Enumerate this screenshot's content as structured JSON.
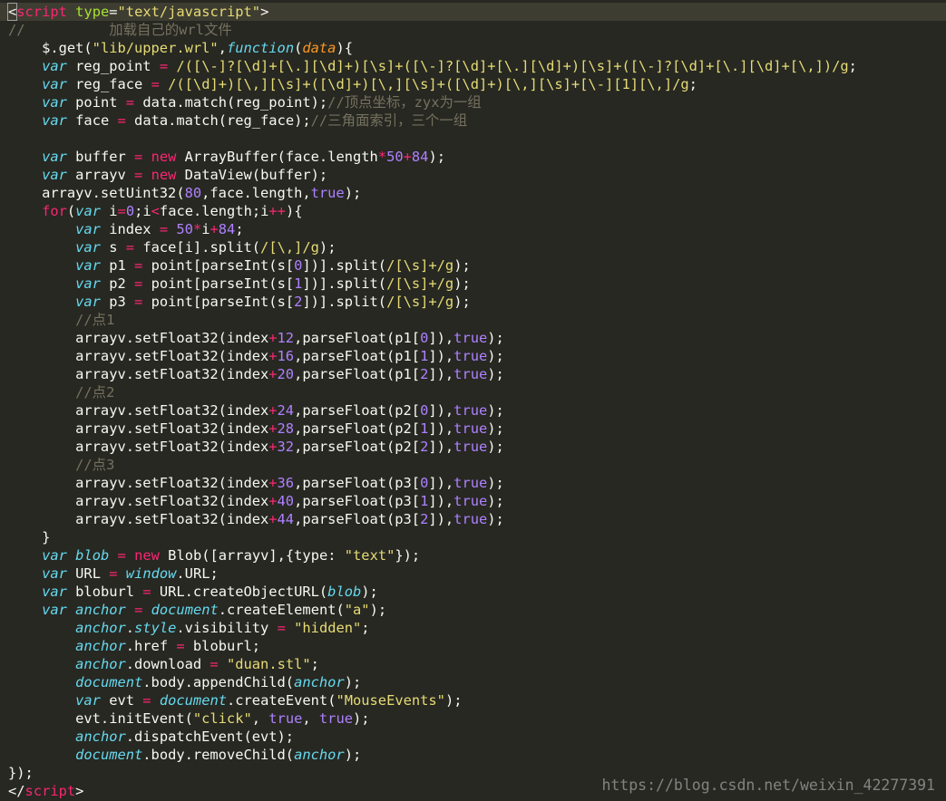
{
  "editor": {
    "theme": {
      "background": "#272822",
      "current_line": "#3e3d32",
      "foreground": "#f8f8f2",
      "keyword": "#f92672",
      "string": "#e6db74",
      "number": "#ae81ff",
      "comment": "#75715e",
      "storage": "#66d9ef",
      "attribute": "#a6e22e",
      "parameter": "#fd971f"
    },
    "lines": [
      [
        [
          "t",
          "<"
        ],
        [
          "k",
          "script"
        ],
        [
          "t",
          " "
        ],
        [
          "a",
          "type"
        ],
        [
          "t",
          "="
        ],
        [
          "s",
          "\"text/javascript\""
        ],
        [
          "t",
          ">"
        ]
      ],
      [
        [
          "c",
          "//          加载自己的wrl文件"
        ]
      ],
      [
        [
          "t",
          "    $.get("
        ],
        [
          "s",
          "\"lib/upper.wrl\""
        ],
        [
          "t",
          ","
        ],
        [
          "v",
          "function"
        ],
        [
          "t",
          "("
        ],
        [
          "p",
          "data"
        ],
        [
          "t",
          "){"
        ]
      ],
      [
        [
          "t",
          "    "
        ],
        [
          "v",
          "var"
        ],
        [
          "t",
          " reg_point "
        ],
        [
          "k",
          "="
        ],
        [
          "t",
          " "
        ],
        [
          "s",
          "/([\\-]?[\\d]+[\\.][\\d]+)[\\s]+([\\-]?[\\d]+[\\.][\\d]+)[\\s]+([\\-]?[\\d]+[\\.][\\d]+[\\,])/g"
        ],
        [
          "t",
          ";"
        ]
      ],
      [
        [
          "t",
          "    "
        ],
        [
          "v",
          "var"
        ],
        [
          "t",
          " reg_face "
        ],
        [
          "k",
          "="
        ],
        [
          "t",
          " "
        ],
        [
          "s",
          "/([\\d]+)[\\,][\\s]+([\\d]+)[\\,][\\s]+([\\d]+)[\\,][\\s]+[\\-][1][\\,]/g"
        ],
        [
          "t",
          ";"
        ]
      ],
      [
        [
          "t",
          "    "
        ],
        [
          "v",
          "var"
        ],
        [
          "t",
          " point "
        ],
        [
          "k",
          "="
        ],
        [
          "t",
          " data.match(reg_point);"
        ],
        [
          "c",
          "//顶点坐标，zyx为一组"
        ]
      ],
      [
        [
          "t",
          "    "
        ],
        [
          "v",
          "var"
        ],
        [
          "t",
          " face "
        ],
        [
          "k",
          "="
        ],
        [
          "t",
          " data.match(reg_face);"
        ],
        [
          "c",
          "//三角面索引，三个一组"
        ]
      ],
      [
        [
          "t",
          ""
        ]
      ],
      [
        [
          "t",
          "    "
        ],
        [
          "v",
          "var"
        ],
        [
          "t",
          " buffer "
        ],
        [
          "k",
          "="
        ],
        [
          "t",
          " "
        ],
        [
          "k",
          "new"
        ],
        [
          "t",
          " ArrayBuffer(face.length"
        ],
        [
          "k",
          "*"
        ],
        [
          "n",
          "50"
        ],
        [
          "k",
          "+"
        ],
        [
          "n",
          "84"
        ],
        [
          "t",
          ");"
        ]
      ],
      [
        [
          "t",
          "    "
        ],
        [
          "v",
          "var"
        ],
        [
          "t",
          " arrayv "
        ],
        [
          "k",
          "="
        ],
        [
          "t",
          " "
        ],
        [
          "k",
          "new"
        ],
        [
          "t",
          " DataView(buffer);"
        ]
      ],
      [
        [
          "t",
          "    arrayv.setUint32("
        ],
        [
          "n",
          "80"
        ],
        [
          "t",
          ",face.length,"
        ],
        [
          "n",
          "true"
        ],
        [
          "t",
          ");"
        ]
      ],
      [
        [
          "t",
          "    "
        ],
        [
          "k",
          "for"
        ],
        [
          "t",
          "("
        ],
        [
          "v",
          "var"
        ],
        [
          "t",
          " i"
        ],
        [
          "k",
          "="
        ],
        [
          "n",
          "0"
        ],
        [
          "t",
          ";i"
        ],
        [
          "k",
          "<"
        ],
        [
          "t",
          "face.length;i"
        ],
        [
          "k",
          "++"
        ],
        [
          "t",
          "){"
        ]
      ],
      [
        [
          "t",
          "        "
        ],
        [
          "v",
          "var"
        ],
        [
          "t",
          " index "
        ],
        [
          "k",
          "="
        ],
        [
          "t",
          " "
        ],
        [
          "n",
          "50"
        ],
        [
          "k",
          "*"
        ],
        [
          "t",
          "i"
        ],
        [
          "k",
          "+"
        ],
        [
          "n",
          "84"
        ],
        [
          "t",
          ";"
        ]
      ],
      [
        [
          "t",
          "        "
        ],
        [
          "v",
          "var"
        ],
        [
          "t",
          " s "
        ],
        [
          "k",
          "="
        ],
        [
          "t",
          " face[i].split("
        ],
        [
          "s",
          "/[\\,]/g"
        ],
        [
          "t",
          ");"
        ]
      ],
      [
        [
          "t",
          "        "
        ],
        [
          "v",
          "var"
        ],
        [
          "t",
          " p1 "
        ],
        [
          "k",
          "="
        ],
        [
          "t",
          " point[parseInt(s["
        ],
        [
          "n",
          "0"
        ],
        [
          "t",
          "])].split("
        ],
        [
          "s",
          "/[\\s]+/g"
        ],
        [
          "t",
          ");"
        ]
      ],
      [
        [
          "t",
          "        "
        ],
        [
          "v",
          "var"
        ],
        [
          "t",
          " p2 "
        ],
        [
          "k",
          "="
        ],
        [
          "t",
          " point[parseInt(s["
        ],
        [
          "n",
          "1"
        ],
        [
          "t",
          "])].split("
        ],
        [
          "s",
          "/[\\s]+/g"
        ],
        [
          "t",
          ");"
        ]
      ],
      [
        [
          "t",
          "        "
        ],
        [
          "v",
          "var"
        ],
        [
          "t",
          " p3 "
        ],
        [
          "k",
          "="
        ],
        [
          "t",
          " point[parseInt(s["
        ],
        [
          "n",
          "2"
        ],
        [
          "t",
          "])].split("
        ],
        [
          "s",
          "/[\\s]+/g"
        ],
        [
          "t",
          ");"
        ]
      ],
      [
        [
          "t",
          "        "
        ],
        [
          "c",
          "//点1"
        ]
      ],
      [
        [
          "t",
          "        arrayv.setFloat32(index"
        ],
        [
          "k",
          "+"
        ],
        [
          "n",
          "12"
        ],
        [
          "t",
          ",parseFloat(p1["
        ],
        [
          "n",
          "0"
        ],
        [
          "t",
          "]),"
        ],
        [
          "n",
          "true"
        ],
        [
          "t",
          ");"
        ]
      ],
      [
        [
          "t",
          "        arrayv.setFloat32(index"
        ],
        [
          "k",
          "+"
        ],
        [
          "n",
          "16"
        ],
        [
          "t",
          ",parseFloat(p1["
        ],
        [
          "n",
          "1"
        ],
        [
          "t",
          "]),"
        ],
        [
          "n",
          "true"
        ],
        [
          "t",
          ");"
        ]
      ],
      [
        [
          "t",
          "        arrayv.setFloat32(index"
        ],
        [
          "k",
          "+"
        ],
        [
          "n",
          "20"
        ],
        [
          "t",
          ",parseFloat(p1["
        ],
        [
          "n",
          "2"
        ],
        [
          "t",
          "]),"
        ],
        [
          "n",
          "true"
        ],
        [
          "t",
          ");"
        ]
      ],
      [
        [
          "t",
          "        "
        ],
        [
          "c",
          "//点2"
        ]
      ],
      [
        [
          "t",
          "        arrayv.setFloat32(index"
        ],
        [
          "k",
          "+"
        ],
        [
          "n",
          "24"
        ],
        [
          "t",
          ",parseFloat(p2["
        ],
        [
          "n",
          "0"
        ],
        [
          "t",
          "]),"
        ],
        [
          "n",
          "true"
        ],
        [
          "t",
          ");"
        ]
      ],
      [
        [
          "t",
          "        arrayv.setFloat32(index"
        ],
        [
          "k",
          "+"
        ],
        [
          "n",
          "28"
        ],
        [
          "t",
          ",parseFloat(p2["
        ],
        [
          "n",
          "1"
        ],
        [
          "t",
          "]),"
        ],
        [
          "n",
          "true"
        ],
        [
          "t",
          ");"
        ]
      ],
      [
        [
          "t",
          "        arrayv.setFloat32(index"
        ],
        [
          "k",
          "+"
        ],
        [
          "n",
          "32"
        ],
        [
          "t",
          ",parseFloat(p2["
        ],
        [
          "n",
          "2"
        ],
        [
          "t",
          "]),"
        ],
        [
          "n",
          "true"
        ],
        [
          "t",
          ");"
        ]
      ],
      [
        [
          "t",
          "        "
        ],
        [
          "c",
          "//点3"
        ]
      ],
      [
        [
          "t",
          "        arrayv.setFloat32(index"
        ],
        [
          "k",
          "+"
        ],
        [
          "n",
          "36"
        ],
        [
          "t",
          ",parseFloat(p3["
        ],
        [
          "n",
          "0"
        ],
        [
          "t",
          "]),"
        ],
        [
          "n",
          "true"
        ],
        [
          "t",
          ");"
        ]
      ],
      [
        [
          "t",
          "        arrayv.setFloat32(index"
        ],
        [
          "k",
          "+"
        ],
        [
          "n",
          "40"
        ],
        [
          "t",
          ",parseFloat(p3["
        ],
        [
          "n",
          "1"
        ],
        [
          "t",
          "]),"
        ],
        [
          "n",
          "true"
        ],
        [
          "t",
          ");"
        ]
      ],
      [
        [
          "t",
          "        arrayv.setFloat32(index"
        ],
        [
          "k",
          "+"
        ],
        [
          "n",
          "44"
        ],
        [
          "t",
          ",parseFloat(p3["
        ],
        [
          "n",
          "2"
        ],
        [
          "t",
          "]),"
        ],
        [
          "n",
          "true"
        ],
        [
          "t",
          ");"
        ]
      ],
      [
        [
          "t",
          "    }"
        ]
      ],
      [
        [
          "t",
          "    "
        ],
        [
          "v",
          "var"
        ],
        [
          "t",
          " "
        ],
        [
          "v",
          "blob"
        ],
        [
          "t",
          " "
        ],
        [
          "k",
          "="
        ],
        [
          "t",
          " "
        ],
        [
          "k",
          "new"
        ],
        [
          "t",
          " Blob([arrayv],{type: "
        ],
        [
          "s",
          "\"text\""
        ],
        [
          "t",
          "});"
        ]
      ],
      [
        [
          "t",
          "    "
        ],
        [
          "v",
          "var"
        ],
        [
          "t",
          " URL "
        ],
        [
          "k",
          "="
        ],
        [
          "t",
          " "
        ],
        [
          "v",
          "window"
        ],
        [
          "t",
          ".URL;"
        ]
      ],
      [
        [
          "t",
          "    "
        ],
        [
          "v",
          "var"
        ],
        [
          "t",
          " bloburl "
        ],
        [
          "k",
          "="
        ],
        [
          "t",
          " URL.createObjectURL("
        ],
        [
          "v",
          "blob"
        ],
        [
          "t",
          ");"
        ]
      ],
      [
        [
          "t",
          "    "
        ],
        [
          "v",
          "var"
        ],
        [
          "t",
          " "
        ],
        [
          "v",
          "anchor"
        ],
        [
          "t",
          " "
        ],
        [
          "k",
          "="
        ],
        [
          "t",
          " "
        ],
        [
          "v",
          "document"
        ],
        [
          "t",
          ".createElement("
        ],
        [
          "s",
          "\"a\""
        ],
        [
          "t",
          ");"
        ]
      ],
      [
        [
          "t",
          "        "
        ],
        [
          "v",
          "anchor"
        ],
        [
          "t",
          "."
        ],
        [
          "v",
          "style"
        ],
        [
          "t",
          ".visibility "
        ],
        [
          "k",
          "="
        ],
        [
          "t",
          " "
        ],
        [
          "s",
          "\"hidden\""
        ],
        [
          "t",
          ";"
        ]
      ],
      [
        [
          "t",
          "        "
        ],
        [
          "v",
          "anchor"
        ],
        [
          "t",
          ".href "
        ],
        [
          "k",
          "="
        ],
        [
          "t",
          " bloburl;"
        ]
      ],
      [
        [
          "t",
          "        "
        ],
        [
          "v",
          "anchor"
        ],
        [
          "t",
          ".download "
        ],
        [
          "k",
          "="
        ],
        [
          "t",
          " "
        ],
        [
          "s",
          "\"duan.stl\""
        ],
        [
          "t",
          ";"
        ]
      ],
      [
        [
          "t",
          "        "
        ],
        [
          "v",
          "document"
        ],
        [
          "t",
          ".body.appendChild("
        ],
        [
          "v",
          "anchor"
        ],
        [
          "t",
          ");"
        ]
      ],
      [
        [
          "t",
          "        "
        ],
        [
          "v",
          "var"
        ],
        [
          "t",
          " evt "
        ],
        [
          "k",
          "="
        ],
        [
          "t",
          " "
        ],
        [
          "v",
          "document"
        ],
        [
          "t",
          ".createEvent("
        ],
        [
          "s",
          "\"MouseEvents\""
        ],
        [
          "t",
          ");"
        ]
      ],
      [
        [
          "t",
          "        evt.initEvent("
        ],
        [
          "s",
          "\"click\""
        ],
        [
          "t",
          ", "
        ],
        [
          "n",
          "true"
        ],
        [
          "t",
          ", "
        ],
        [
          "n",
          "true"
        ],
        [
          "t",
          ");"
        ]
      ],
      [
        [
          "t",
          "        "
        ],
        [
          "v",
          "anchor"
        ],
        [
          "t",
          ".dispatchEvent(evt);"
        ]
      ],
      [
        [
          "t",
          "        "
        ],
        [
          "v",
          "document"
        ],
        [
          "t",
          ".body.removeChild("
        ],
        [
          "v",
          "anchor"
        ],
        [
          "t",
          ");"
        ]
      ],
      [
        [
          "t",
          "});"
        ]
      ],
      [
        [
          "t",
          "</"
        ],
        [
          "k",
          "script"
        ],
        [
          "t",
          ">"
        ]
      ]
    ]
  },
  "watermark": "https://blog.csdn.net/weixin_42277391"
}
